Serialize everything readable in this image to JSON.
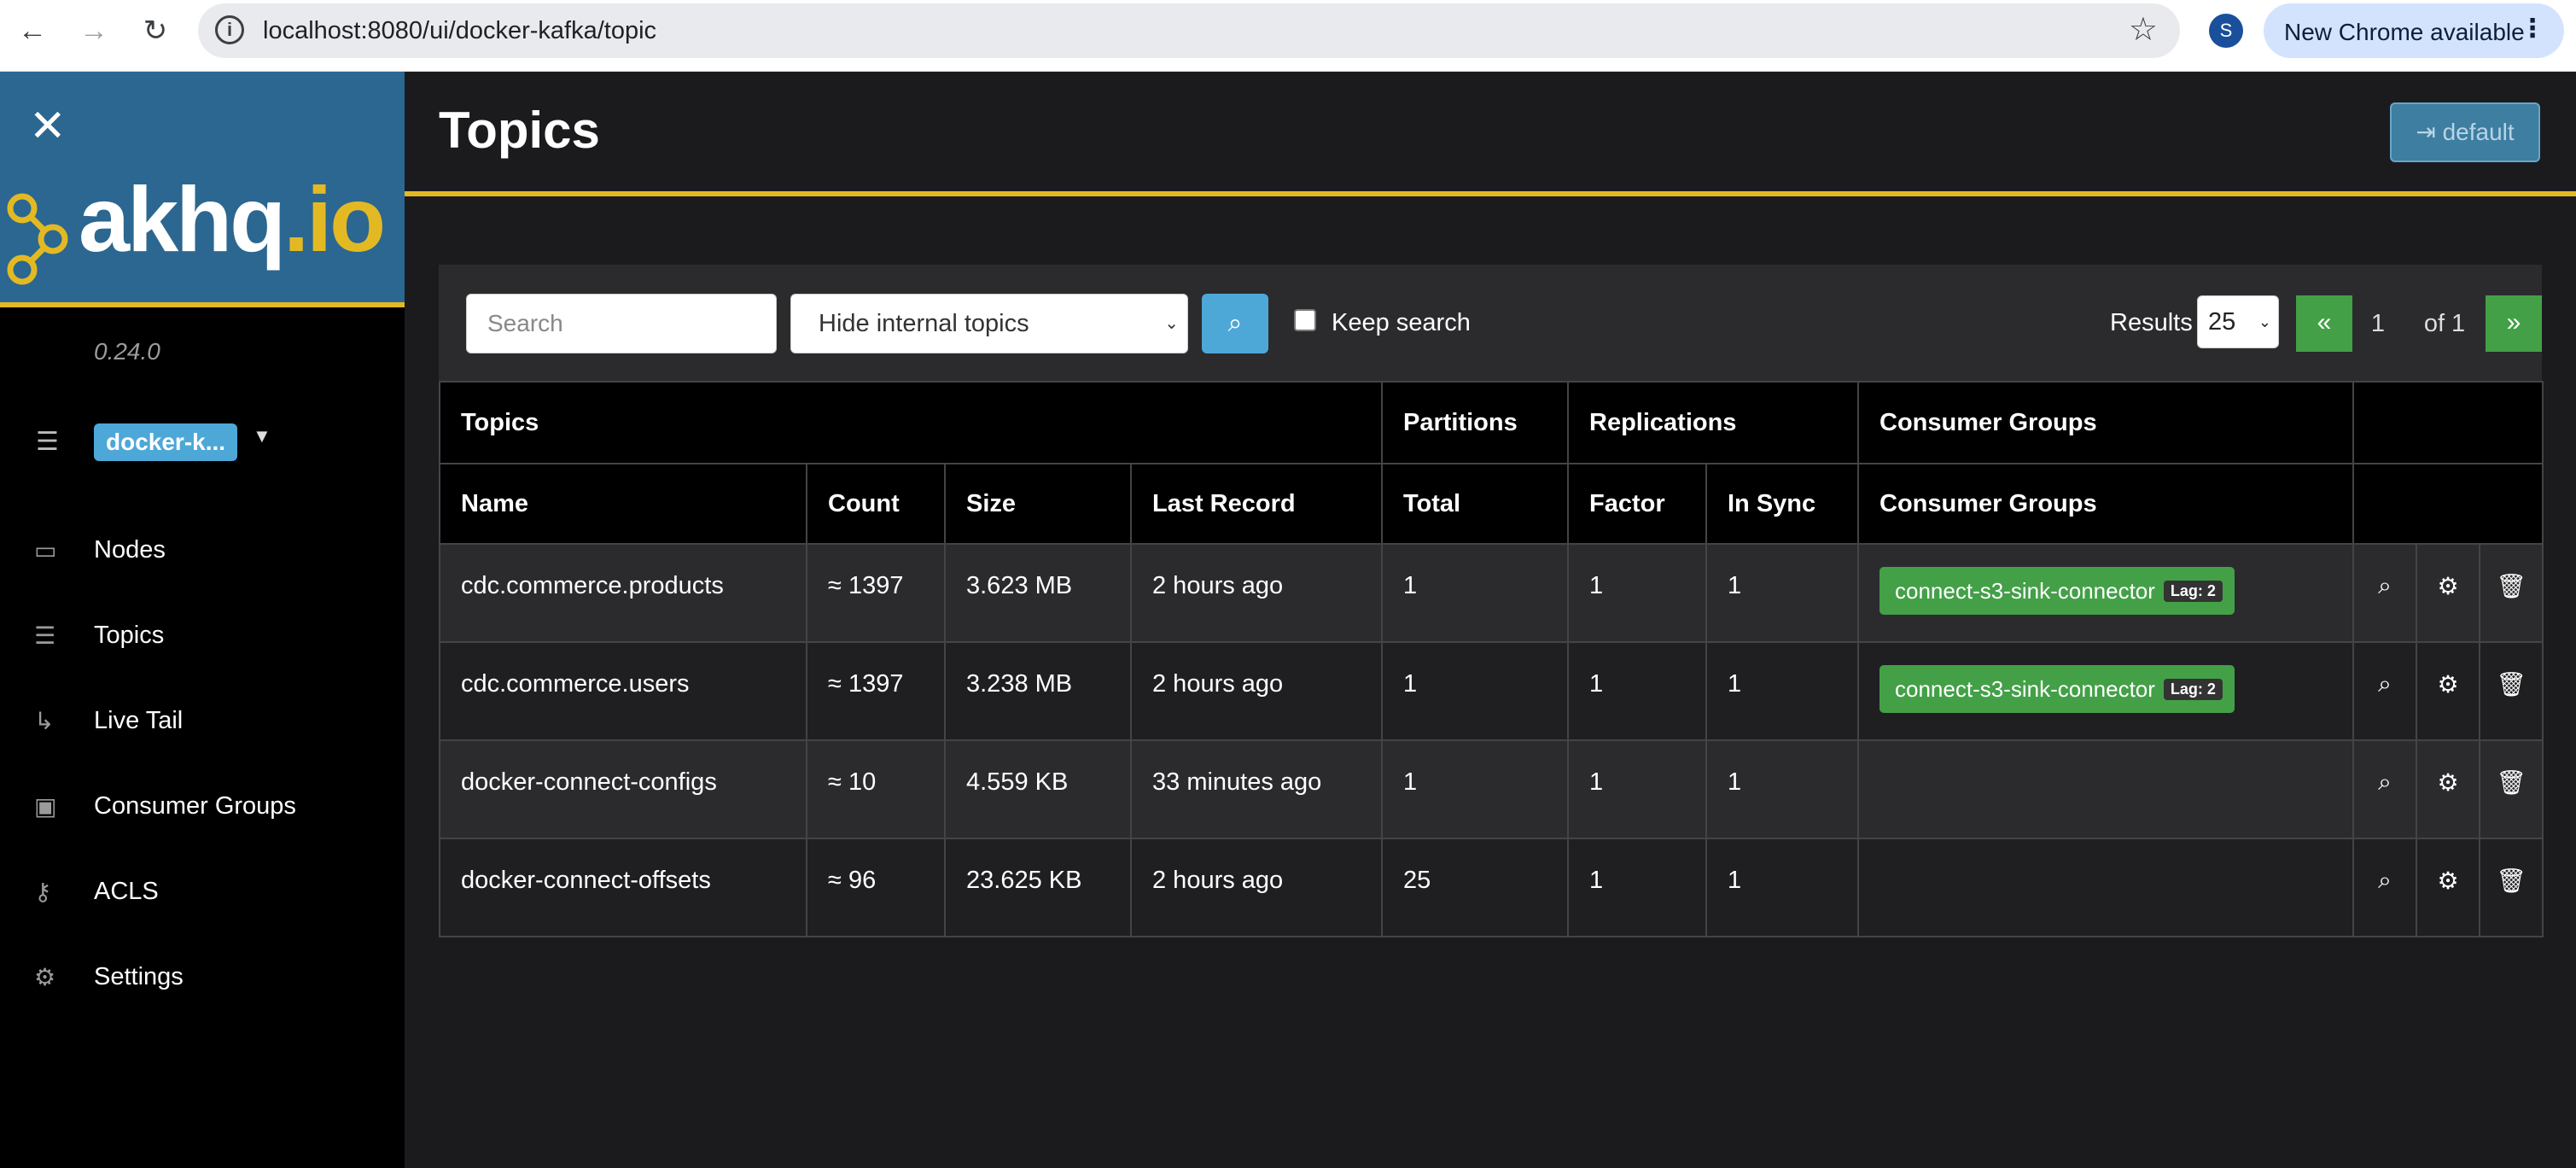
{
  "browser": {
    "url": "localhost:8080/ui/docker-kafka/topic",
    "profile_initial": "S",
    "update_label": "New Chrome available"
  },
  "sidebar": {
    "logo_text_main": "akhq",
    "logo_text_accent": ".io",
    "version": "0.24.0",
    "cluster": "docker-k...",
    "items": [
      {
        "label": "Nodes",
        "icon": "laptop-icon"
      },
      {
        "label": "Topics",
        "icon": "list-icon"
      },
      {
        "label": "Live Tail",
        "icon": "level-down-icon"
      },
      {
        "label": "Consumer Groups",
        "icon": "object-group-icon"
      },
      {
        "label": "ACLS",
        "icon": "key-icon"
      },
      {
        "label": "Settings",
        "icon": "gear-icon"
      }
    ]
  },
  "header": {
    "title": "Topics",
    "user_button": "default"
  },
  "toolbar": {
    "search_placeholder": "Search",
    "filter_selected": "Hide internal topics",
    "keep_search_label": "Keep search",
    "results_label": "Results",
    "results_per_page": "25",
    "pager_prev": "«",
    "pager_current": "1",
    "pager_of": "of 1",
    "pager_next": "»"
  },
  "table": {
    "group_headers": [
      "Topics",
      "Partitions",
      "Replications",
      "Consumer Groups",
      ""
    ],
    "columns": [
      "Name",
      "Count",
      "Size",
      "Last Record",
      "Total",
      "Factor",
      "In Sync",
      "Consumer Groups"
    ],
    "rows": [
      {
        "name": "cdc.commerce.products",
        "count": "≈ 1397",
        "size": "3.623 MB",
        "last_record": "2 hours ago",
        "total": "1",
        "factor": "1",
        "in_sync": "1",
        "consumer_group": "connect-s3-sink-connector",
        "lag": "Lag: 2"
      },
      {
        "name": "cdc.commerce.users",
        "count": "≈ 1397",
        "size": "3.238 MB",
        "last_record": "2 hours ago",
        "total": "1",
        "factor": "1",
        "in_sync": "1",
        "consumer_group": "connect-s3-sink-connector",
        "lag": "Lag: 2"
      },
      {
        "name": "docker-connect-configs",
        "count": "≈ 10",
        "size": "4.559 KB",
        "last_record": "33 minutes ago",
        "total": "1",
        "factor": "1",
        "in_sync": "1",
        "consumer_group": "",
        "lag": ""
      },
      {
        "name": "docker-connect-offsets",
        "count": "≈ 96",
        "size": "23.625 KB",
        "last_record": "2 hours ago",
        "total": "25",
        "factor": "1",
        "in_sync": "1",
        "consumer_group": "",
        "lag": ""
      }
    ]
  },
  "colors": {
    "accent_yellow": "#e3b923",
    "logo_blue": "#2b6790",
    "success_green": "#43a047",
    "info_blue": "#4da8d8"
  }
}
